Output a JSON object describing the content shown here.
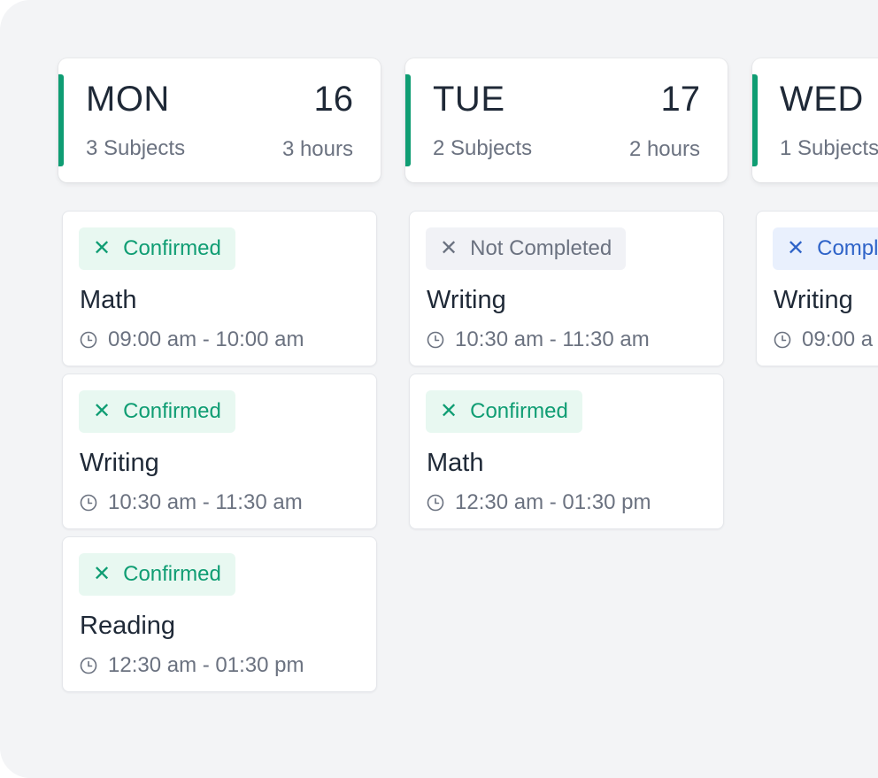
{
  "days": [
    {
      "name": "MON",
      "date": "16",
      "subjects": "3 Subjects",
      "hours": "3 hours",
      "items": [
        {
          "status": "Confirmed",
          "status_type": "green",
          "subject": "Math",
          "time": "09:00 am - 10:00 am"
        },
        {
          "status": "Confirmed",
          "status_type": "green",
          "subject": "Writing",
          "time": "10:30 am - 11:30 am"
        },
        {
          "status": "Confirmed",
          "status_type": "green",
          "subject": "Reading",
          "time": "12:30 am - 01:30 pm"
        }
      ]
    },
    {
      "name": "TUE",
      "date": "17",
      "subjects": "2 Subjects",
      "hours": "2 hours",
      "items": [
        {
          "status": "Not Completed",
          "status_type": "gray",
          "subject": "Writing",
          "time": "10:30 am - 11:30 am"
        },
        {
          "status": "Confirmed",
          "status_type": "green",
          "subject": "Math",
          "time": "12:30 am - 01:30 pm"
        }
      ]
    },
    {
      "name": "WED",
      "date": "",
      "subjects": "1 Subjects",
      "hours": "",
      "items": [
        {
          "status": "Compl",
          "status_type": "blue",
          "subject": "Writing",
          "time": "09:00 a"
        }
      ]
    }
  ],
  "icons": {
    "status": "close-icon",
    "time": "clock-icon"
  },
  "colors": {
    "accent": "#0f9d73",
    "confirmed": "#0f9d73",
    "not_completed": "#6b7280",
    "completed": "#2e63c8"
  }
}
